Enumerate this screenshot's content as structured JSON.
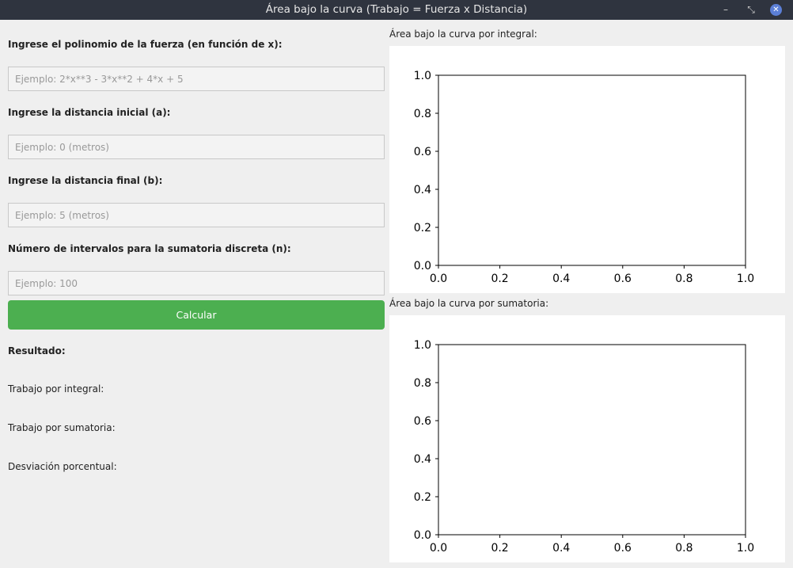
{
  "window": {
    "title": "Área bajo la curva (Trabajo = Fuerza x Distancia)",
    "minimize_glyph": "–",
    "maximize_glyph": "⤡",
    "close_glyph": "✕"
  },
  "form": {
    "polynomial": {
      "label": "Ingrese el polinomio de la fuerza (en función de x):",
      "placeholder": "Ejemplo: 2*x**3 - 3*x**2 + 4*x + 5",
      "value": ""
    },
    "start": {
      "label": "Ingrese la distancia inicial (a):",
      "placeholder": "Ejemplo: 0 (metros)",
      "value": ""
    },
    "end": {
      "label": "Ingrese la distancia final (b):",
      "placeholder": "Ejemplo: 5 (metros)",
      "value": ""
    },
    "intervals": {
      "label": "Número de intervalos para la sumatoria discreta (n):",
      "placeholder": "Ejemplo: 100",
      "value": ""
    },
    "calculate_label": "Calcular",
    "accent_color": "#4caf50"
  },
  "results": {
    "heading": "Resultado:",
    "integral_label": "Trabajo por integral:",
    "sum_label": "Trabajo por sumatoria:",
    "deviation_label": "Desviación porcentual:"
  },
  "plots": {
    "integral_title": "Área bajo la curva por integral:",
    "sum_title": "Área bajo la curva por sumatoria:"
  },
  "chart_data": [
    {
      "type": "line",
      "series": [],
      "xlim": [
        0.0,
        1.0
      ],
      "ylim": [
        0.0,
        1.0
      ],
      "xticks": [
        "0.0",
        "0.2",
        "0.4",
        "0.6",
        "0.8",
        "1.0"
      ],
      "yticks": [
        "0.0",
        "0.2",
        "0.4",
        "0.6",
        "0.8",
        "1.0"
      ],
      "grid": false
    },
    {
      "type": "line",
      "series": [],
      "xlim": [
        0.0,
        1.0
      ],
      "ylim": [
        0.0,
        1.0
      ],
      "xticks": [
        "0.0",
        "0.2",
        "0.4",
        "0.6",
        "0.8",
        "1.0"
      ],
      "yticks": [
        "0.0",
        "0.2",
        "0.4",
        "0.6",
        "0.8",
        "1.0"
      ],
      "grid": false
    }
  ]
}
